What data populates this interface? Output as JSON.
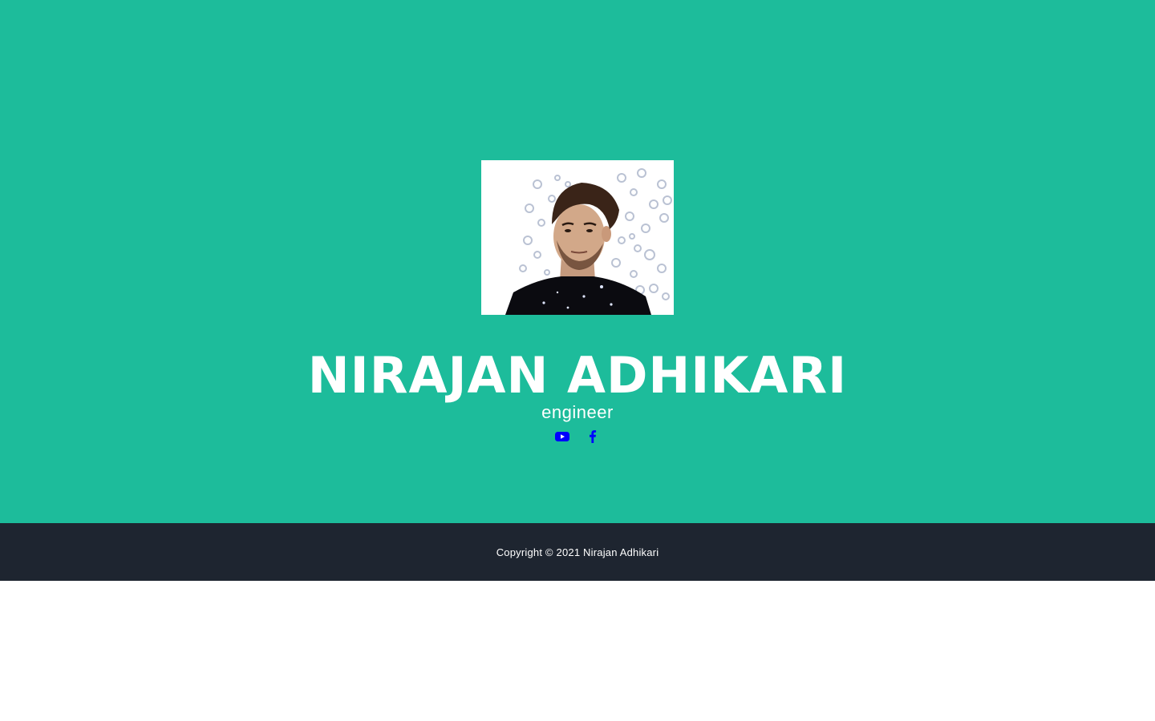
{
  "profile": {
    "name": "NIRAJAN ADHIKARI",
    "role": "engineer",
    "avatar_icon": "profile-photo"
  },
  "socials": [
    {
      "name": "youtube",
      "icon": "youtube-icon",
      "color": "#0000ff"
    },
    {
      "name": "facebook",
      "icon": "facebook-icon",
      "color": "#0000ff"
    }
  ],
  "footer": {
    "copyright": "Copyright © 2021 Nirajan Adhikari"
  },
  "colors": {
    "hero_bg": "#1dbc9b",
    "footer_bg": "#1e2530",
    "link": "#0000ff"
  }
}
